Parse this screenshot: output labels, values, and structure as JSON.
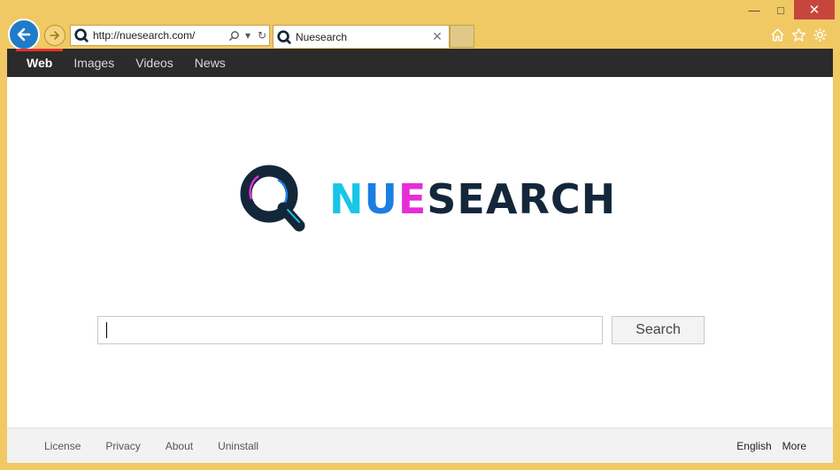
{
  "browser": {
    "url": "http://nuesearch.com/",
    "tab_title": "Nuesearch",
    "window_controls": [
      "minimize-icon",
      "maximize-icon",
      "close-icon"
    ],
    "toolbar_icons": [
      "home-icon",
      "star-icon",
      "gear-icon"
    ]
  },
  "nav": {
    "items": [
      {
        "label": "Web",
        "active": true
      },
      {
        "label": "Images"
      },
      {
        "label": "Videos"
      },
      {
        "label": "News"
      }
    ]
  },
  "logo": {
    "text_n": "N",
    "text_u": "U",
    "text_e": "E",
    "text_rest": "SEARCH"
  },
  "search": {
    "value": "",
    "button_label": "Search"
  },
  "footer": {
    "left_links": [
      "License",
      "Privacy",
      "About",
      "Uninstall"
    ],
    "language": "English",
    "more": "More"
  },
  "colors": {
    "chrome": "#f0c964",
    "nav_bg": "#2b2b2b",
    "nav_active_indicator": "#e0322b",
    "logo_cyan": "#18c6e8",
    "logo_blue": "#1a7fe0",
    "logo_magenta": "#e52ed7",
    "logo_dark": "#14273a"
  }
}
